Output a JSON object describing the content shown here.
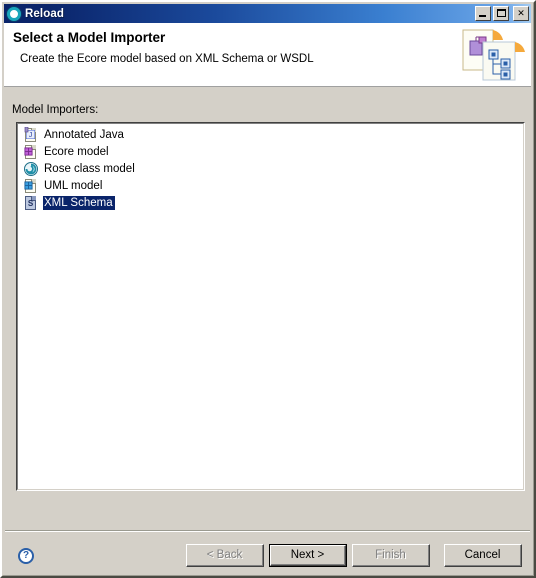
{
  "window": {
    "title": "Reload",
    "title_icon": "reload-circle-icon",
    "controls": [
      {
        "name": "minimize-button",
        "label": "_"
      },
      {
        "name": "maximize-button",
        "label": "□"
      },
      {
        "name": "close-button",
        "label": "✕"
      }
    ],
    "titlebar_gradient_start": "#0a246a",
    "titlebar_gradient_end": "#a6cdf2"
  },
  "header": {
    "title": "Select a Model Importer",
    "description": "Create the Ecore model based on XML Schema or WSDL",
    "banner_icon": "model-import-documents-icon",
    "background": "#ffffff"
  },
  "content": {
    "list_label": "Model Importers:",
    "items": [
      {
        "label": "Annotated Java",
        "icon": "annotated-java-file-icon",
        "selected": false,
        "badge_color": "#3f5fd0"
      },
      {
        "label": "Ecore model",
        "icon": "ecore-model-file-icon",
        "selected": false,
        "badge_color": "#b44bd6"
      },
      {
        "label": "Rose class model",
        "icon": "rose-class-model-icon",
        "selected": false,
        "badge_color": "#1e8fa8"
      },
      {
        "label": "UML model",
        "icon": "uml-model-file-icon",
        "selected": false,
        "badge_color": "#2e86d8"
      },
      {
        "label": "XML Schema",
        "icon": "xml-schema-file-icon",
        "selected": true,
        "badge_color": "#5a7fc0"
      }
    ],
    "selection_background": "#0a246a",
    "selection_text_color": "#ffffff"
  },
  "footer": {
    "help_icon": "help-question-icon",
    "help_label": "?",
    "buttons": [
      {
        "name": "back-button",
        "label": "< Back",
        "disabled": true,
        "default": false
      },
      {
        "name": "next-button",
        "label": "Next >",
        "disabled": false,
        "default": true
      },
      {
        "name": "finish-button",
        "label": "Finish",
        "disabled": true,
        "default": false
      },
      {
        "name": "cancel-button",
        "label": "Cancel",
        "disabled": false,
        "default": false
      }
    ]
  },
  "theme": {
    "face": "#d4d0c8",
    "text": "#000000",
    "disabled_text": "#808080"
  }
}
